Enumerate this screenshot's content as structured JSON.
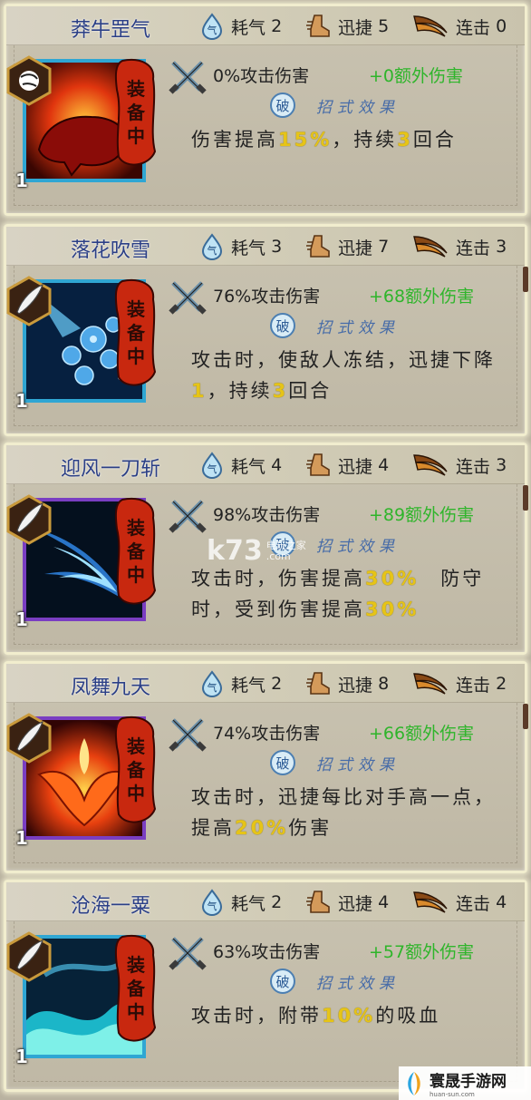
{
  "cards": [
    {
      "name": "莽牛罡气",
      "cost_label": "耗气",
      "cost": "2",
      "agility_label": "迅捷",
      "agility": "5",
      "combo_label": "连击",
      "combo": "0",
      "level": "1",
      "equipped_label": [
        "装",
        "备",
        "中"
      ],
      "attack": "0%攻击伤害",
      "extra": "+0额外伤害",
      "effect_badge": "破",
      "effect_label": "招式效果",
      "desc_parts": [
        {
          "t": "伤害提高"
        },
        {
          "t": "15%",
          "hl": true
        },
        {
          "t": "，持续"
        },
        {
          "t": "3",
          "hl": true
        },
        {
          "t": "回合"
        }
      ],
      "frame": "blue",
      "icon": "bull-art"
    },
    {
      "name": "落花吹雪",
      "cost_label": "耗气",
      "cost": "3",
      "agility_label": "迅捷",
      "agility": "7",
      "combo_label": "连击",
      "combo": "3",
      "level": "1",
      "equipped_label": [
        "装",
        "备",
        "中"
      ],
      "attack": "76%攻击伤害",
      "extra": "+68额外伤害",
      "effect_badge": "破",
      "effect_label": "招式效果",
      "desc_parts": [
        {
          "t": "攻击时，使敌人冻结，迅捷下降"
        },
        {
          "t": "1",
          "hl": true
        },
        {
          "t": "，持续"
        },
        {
          "t": "3",
          "hl": true
        },
        {
          "t": "回合"
        }
      ],
      "frame": "blue",
      "icon": "snowflake-art"
    },
    {
      "name": "迎风一刀斩",
      "cost_label": "耗气",
      "cost": "4",
      "agility_label": "迅捷",
      "agility": "4",
      "combo_label": "连击",
      "combo": "3",
      "level": "1",
      "equipped_label": [
        "装",
        "备",
        "中"
      ],
      "attack": "98%攻击伤害",
      "extra": "+89额外伤害",
      "effect_badge": "破",
      "effect_label": "招式效果",
      "desc_parts": [
        {
          "t": "攻击时，伤害提高"
        },
        {
          "t": "30%",
          "hl": true
        },
        {
          "t": "　防守时，受到伤害提高"
        },
        {
          "t": "30%",
          "hl": true
        }
      ],
      "frame": "purple",
      "icon": "blade-wind-art"
    },
    {
      "name": "凤舞九天",
      "cost_label": "耗气",
      "cost": "2",
      "agility_label": "迅捷",
      "agility": "8",
      "combo_label": "连击",
      "combo": "2",
      "level": "1",
      "equipped_label": [
        "装",
        "备",
        "中"
      ],
      "attack": "74%攻击伤害",
      "extra": "+66额外伤害",
      "effect_badge": "破",
      "effect_label": "招式效果",
      "desc_parts": [
        {
          "t": "攻击时，迅捷每比对手高一点，提高"
        },
        {
          "t": "20%",
          "hl": true
        },
        {
          "t": "伤害"
        }
      ],
      "frame": "purple",
      "icon": "phoenix-art"
    },
    {
      "name": "沧海一粟",
      "cost_label": "耗气",
      "cost": "2",
      "agility_label": "迅捷",
      "agility": "4",
      "combo_label": "连击",
      "combo": "4",
      "level": "1",
      "equipped_label": [
        "装",
        "备",
        "中"
      ],
      "attack": "63%攻击伤害",
      "extra": "+57额外伤害",
      "effect_badge": "破",
      "effect_label": "招式效果",
      "desc_parts": [
        {
          "t": "攻击时，附带"
        },
        {
          "t": "10%",
          "hl": true
        },
        {
          "t": "的吸血"
        }
      ],
      "frame": "blue",
      "icon": "wave-art"
    }
  ],
  "watermark_center": {
    "main": "k73",
    "sub1": "电玩之家",
    "sub2": ".com"
  },
  "watermark_corner": {
    "title": "寰晟手游网",
    "url": "huan-sun.com"
  },
  "colors": {
    "name": "#2b3f86",
    "extra": "#2fb52b",
    "highlight": "#e6c417",
    "frame_blue": "#2fa6d3",
    "frame_purple": "#7a3ec2"
  }
}
